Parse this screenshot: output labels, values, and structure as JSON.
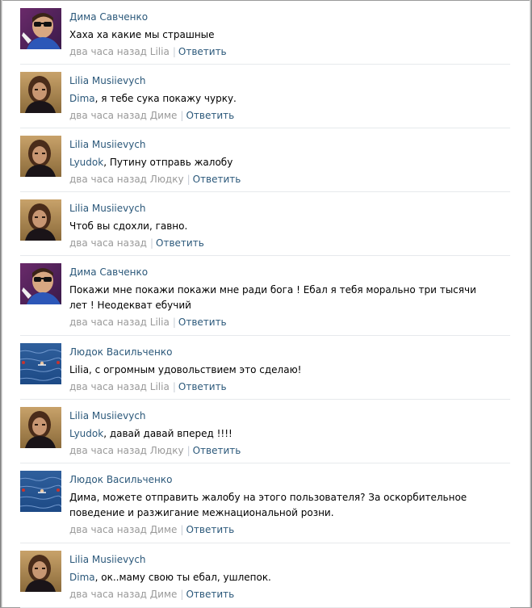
{
  "comments": [
    {
      "avatar": "dima",
      "author": "Дима Савченко",
      "reply_to": "",
      "text": "Хаха ха какие мы страшные",
      "time": "два часа назад Lilia",
      "reply_label": "Ответить"
    },
    {
      "avatar": "lilia",
      "author": "Lilia Musiievych",
      "reply_to": "Dima",
      "text": ", я тебе сука покажу чурку.",
      "time": "два часа назад Диме",
      "reply_label": "Ответить"
    },
    {
      "avatar": "lilia",
      "author": "Lilia Musiievych",
      "reply_to": "Lyudok",
      "text": ", Путину отправь жалобу",
      "time": "два часа назад Людку",
      "reply_label": "Ответить"
    },
    {
      "avatar": "lilia",
      "author": "Lilia Musiievych",
      "reply_to": "",
      "text": "Чтоб вы сдохли, гавно.",
      "time": "два часа назад",
      "reply_label": "Ответить"
    },
    {
      "avatar": "dima",
      "author": "Дима Савченко",
      "reply_to": "",
      "text": "Покажи мне покажи покажи мне ради бога ! Ебал я тебя морально три тысячи лет ! Неодекват ебучий",
      "time": "два часа назад Lilia",
      "reply_label": "Ответить"
    },
    {
      "avatar": "sea",
      "author": "Людок Васильченко",
      "reply_to": "",
      "text": "Lilia, с огромным удовольствием это сделаю!",
      "time": "два часа назад Lilia",
      "reply_label": "Ответить"
    },
    {
      "avatar": "lilia",
      "author": "Lilia Musiievych",
      "reply_to": "Lyudok",
      "text": ", давай давай вперед !!!!",
      "time": "два часа назад Людку",
      "reply_label": "Ответить"
    },
    {
      "avatar": "sea",
      "author": "Людок Васильченко",
      "reply_to": "",
      "text": "Дима, можете отправить жалобу на этого пользователя? За оскорбительное поведение и разжигание межнациональной розни.",
      "time": "два часа назад Диме",
      "reply_label": "Ответить"
    },
    {
      "avatar": "lilia",
      "author": "Lilia Musiievych",
      "reply_to": "Dima",
      "text": ", ок..маму свою ты ебал, ушлепок.",
      "time": "два часа назад Диме",
      "reply_label": "Ответить"
    }
  ],
  "colors": {
    "link": "#2b587a",
    "meta": "#999999",
    "divider": "#e6e9ec"
  }
}
